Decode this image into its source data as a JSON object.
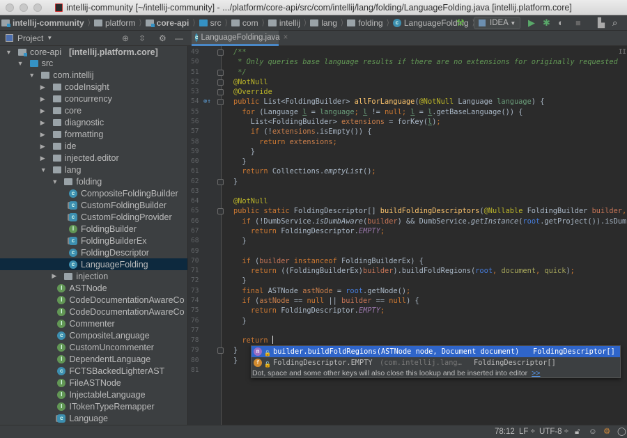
{
  "window": {
    "title": "intellij-community [~/intellij-community] - .../platform/core-api/src/com/intellij/lang/folding/LanguageFolding.java [intellij.platform.core]"
  },
  "navbar": {
    "breadcrumbs": [
      {
        "label": "intellij-community",
        "icon": "module-folder",
        "bold": true
      },
      {
        "label": "platform",
        "icon": "folder",
        "bold": false
      },
      {
        "label": "core-api",
        "icon": "module-folder",
        "bold": true
      },
      {
        "label": "src",
        "icon": "source-folder",
        "bold": false
      },
      {
        "label": "com",
        "icon": "package",
        "bold": false
      },
      {
        "label": "intellij",
        "icon": "package",
        "bold": false
      },
      {
        "label": "lang",
        "icon": "package",
        "bold": false
      },
      {
        "label": "folding",
        "icon": "package",
        "bold": false
      },
      {
        "label": "LanguageFolding",
        "icon": "class",
        "bold": false
      }
    ],
    "run_config": "IDEA"
  },
  "project_panel": {
    "title": "Project"
  },
  "editor_tab": {
    "label": "LanguageFolding.java",
    "close": "×"
  },
  "tree": [
    {
      "label": "core-api",
      "suffix": "[intellij.platform.core]",
      "depth": 0,
      "icon": "module",
      "expanded": true
    },
    {
      "label": "src",
      "depth": 1,
      "icon": "source",
      "expanded": true
    },
    {
      "label": "com.intellij",
      "depth": 2,
      "icon": "package",
      "expanded": true
    },
    {
      "label": "codeInsight",
      "depth": 3,
      "icon": "package",
      "expanded": false
    },
    {
      "label": "concurrency",
      "depth": 3,
      "icon": "package",
      "expanded": false
    },
    {
      "label": "core",
      "depth": 3,
      "icon": "package",
      "expanded": false
    },
    {
      "label": "diagnostic",
      "depth": 3,
      "icon": "package",
      "expanded": false
    },
    {
      "label": "formatting",
      "depth": 3,
      "icon": "package",
      "expanded": false
    },
    {
      "label": "ide",
      "depth": 3,
      "icon": "package",
      "expanded": false
    },
    {
      "label": "injected.editor",
      "depth": 3,
      "icon": "package",
      "expanded": false
    },
    {
      "label": "lang",
      "depth": 3,
      "icon": "package",
      "expanded": true
    },
    {
      "label": "folding",
      "depth": 4,
      "icon": "package",
      "expanded": true
    },
    {
      "label": "CompositeFoldingBuilder",
      "depth": 5,
      "icon": "class"
    },
    {
      "label": "CustomFoldingBuilder",
      "depth": 5,
      "icon": "abstract-class"
    },
    {
      "label": "CustomFoldingProvider",
      "depth": 5,
      "icon": "abstract-class"
    },
    {
      "label": "FoldingBuilder",
      "depth": 5,
      "icon": "interface"
    },
    {
      "label": "FoldingBuilderEx",
      "depth": 5,
      "icon": "abstract-class"
    },
    {
      "label": "FoldingDescriptor",
      "depth": 5,
      "icon": "class"
    },
    {
      "label": "LanguageFolding",
      "depth": 5,
      "icon": "class",
      "selected": true
    },
    {
      "label": "injection",
      "depth": 4,
      "icon": "package",
      "expanded": false
    },
    {
      "label": "ASTNode",
      "depth": 4,
      "icon": "interface"
    },
    {
      "label": "CodeDocumentationAwareCo",
      "depth": 4,
      "icon": "interface"
    },
    {
      "label": "CodeDocumentationAwareCo",
      "depth": 4,
      "icon": "interface"
    },
    {
      "label": "Commenter",
      "depth": 4,
      "icon": "interface"
    },
    {
      "label": "CompositeLanguage",
      "depth": 4,
      "icon": "class"
    },
    {
      "label": "CustomUncommenter",
      "depth": 4,
      "icon": "interface"
    },
    {
      "label": "DependentLanguage",
      "depth": 4,
      "icon": "interface"
    },
    {
      "label": "FCTSBackedLighterAST",
      "depth": 4,
      "icon": "class"
    },
    {
      "label": "FileASTNode",
      "depth": 4,
      "icon": "interface"
    },
    {
      "label": "InjectableLanguage",
      "depth": 4,
      "icon": "interface"
    },
    {
      "label": "ITokenTypeRemapper",
      "depth": 4,
      "icon": "interface"
    },
    {
      "label": "Language",
      "depth": 4,
      "icon": "abstract-class"
    }
  ],
  "code": {
    "first_line": 49,
    "lines": [
      [
        [
          "cm",
          "/**"
        ]
      ],
      [
        [
          "cm",
          " * Only queries base language results if there are no extensions for originally requested"
        ]
      ],
      [
        [
          "cm",
          " */"
        ]
      ],
      [
        [
          "an",
          "@NotNull"
        ]
      ],
      [
        [
          "an",
          "@Override"
        ]
      ],
      [
        [
          "kw",
          "public "
        ],
        [
          "",
          "List<FoldingBuilder> "
        ],
        [
          "fn",
          "allForLanguage"
        ],
        [
          "",
          "("
        ],
        [
          "an",
          "@NotNull "
        ],
        [
          "",
          "Language "
        ],
        [
          "pm",
          "language"
        ],
        [
          "",
          ") {"
        ]
      ],
      [
        [
          "",
          "  "
        ],
        [
          "kw",
          "for "
        ],
        [
          "",
          "(Language "
        ],
        [
          "lv",
          "l"
        ],
        [
          "",
          " = "
        ],
        [
          "pm",
          "language"
        ],
        [
          "kw",
          "; "
        ],
        [
          "lv",
          "l"
        ],
        [
          "",
          " != "
        ],
        [
          "kw",
          "null; "
        ],
        [
          "lv",
          "l"
        ],
        [
          "",
          " = "
        ],
        [
          "lv",
          "l"
        ],
        [
          "",
          ".getBaseLanguage()) {"
        ]
      ],
      [
        [
          "",
          "    List<FoldingBuilder> "
        ],
        [
          "fd",
          "extensions"
        ],
        [
          "",
          " = forKey("
        ],
        [
          "lv",
          "l"
        ],
        [
          "",
          ")"
        ],
        [
          "kw",
          ";"
        ]
      ],
      [
        [
          "",
          "    "
        ],
        [
          "kw",
          "if "
        ],
        [
          "",
          "(!"
        ],
        [
          "fd",
          "extensions"
        ],
        [
          "",
          ".isEmpty()) {"
        ]
      ],
      [
        [
          "",
          "      "
        ],
        [
          "kw",
          "return "
        ],
        [
          "fd",
          "extensions"
        ],
        [
          "kw",
          ";"
        ]
      ],
      [
        [
          "",
          "    }"
        ]
      ],
      [
        [
          "",
          "  }"
        ]
      ],
      [
        [
          "",
          "  "
        ],
        [
          "kw",
          "return "
        ],
        [
          "",
          "Collections."
        ],
        [
          "it",
          "emptyList"
        ],
        [
          "",
          "()"
        ],
        [
          "kw",
          ";"
        ]
      ],
      [
        [
          "",
          "}"
        ]
      ],
      [],
      [
        [
          "an",
          "@NotNull"
        ]
      ],
      [
        [
          "kw",
          "public static "
        ],
        [
          "",
          "FoldingDescriptor[] "
        ],
        [
          "fn",
          "buildFoldingDescriptors"
        ],
        [
          "",
          "("
        ],
        [
          "an",
          "@Nullable "
        ],
        [
          "",
          "FoldingBuilder "
        ],
        [
          "bp",
          "builder"
        ],
        [
          "kw",
          ","
        ]
      ],
      [
        [
          "",
          "  "
        ],
        [
          "kw",
          "if "
        ],
        [
          "",
          "(!DumbService."
        ],
        [
          "it",
          "isDumbAware"
        ],
        [
          "",
          "("
        ],
        [
          "bp",
          "builder"
        ],
        [
          "",
          ") && DumbService."
        ],
        [
          "it",
          "getInstance"
        ],
        [
          "",
          "("
        ],
        [
          "rt",
          "root"
        ],
        [
          "",
          ".getProject()).isDumbMode()"
        ]
      ],
      [
        [
          "",
          "    "
        ],
        [
          "kw",
          "return "
        ],
        [
          "",
          "FoldingDescriptor."
        ],
        [
          "st",
          "EMPTY"
        ],
        [
          "kw",
          ";"
        ]
      ],
      [
        [
          "",
          "  }"
        ]
      ],
      [],
      [
        [
          "",
          "  "
        ],
        [
          "kw",
          "if "
        ],
        [
          "",
          "("
        ],
        [
          "bp",
          "builder "
        ],
        [
          "kw",
          "instanceof "
        ],
        [
          "",
          "FoldingBuilderEx) {"
        ]
      ],
      [
        [
          "",
          "    "
        ],
        [
          "kw",
          "return "
        ],
        [
          "",
          "((FoldingBuilderEx)"
        ],
        [
          "bp",
          "builder"
        ],
        [
          "",
          ").buildFoldRegions("
        ],
        [
          "rt",
          "root"
        ],
        [
          "kw",
          ", "
        ],
        [
          "ol",
          "document"
        ],
        [
          "kw",
          ", "
        ],
        [
          "ol",
          "quick"
        ],
        [
          "",
          ")"
        ],
        [
          "kw",
          ";"
        ]
      ],
      [
        [
          "",
          "  }"
        ]
      ],
      [
        [
          "",
          "  "
        ],
        [
          "kw",
          "final "
        ],
        [
          "",
          "ASTNode "
        ],
        [
          "fd",
          "astNode"
        ],
        [
          "",
          " = "
        ],
        [
          "rt",
          "root"
        ],
        [
          "",
          ".getNode()"
        ],
        [
          "kw",
          ";"
        ]
      ],
      [
        [
          "",
          "  "
        ],
        [
          "kw",
          "if "
        ],
        [
          "",
          "("
        ],
        [
          "fd",
          "astNode"
        ],
        [
          "",
          " == "
        ],
        [
          "kw",
          "null "
        ],
        [
          "",
          "|| "
        ],
        [
          "bp",
          "builder"
        ],
        [
          "",
          " == "
        ],
        [
          "kw",
          "null"
        ],
        [
          "",
          ") {"
        ]
      ],
      [
        [
          "",
          "    "
        ],
        [
          "kw",
          "return "
        ],
        [
          "",
          "FoldingDescriptor."
        ],
        [
          "st",
          "EMPTY"
        ],
        [
          "kw",
          ";"
        ]
      ],
      [
        [
          "",
          "  }"
        ]
      ],
      [],
      [
        [
          "",
          "  "
        ],
        [
          "kw",
          "return "
        ]
      ],
      [
        [
          "",
          "}"
        ]
      ],
      [
        [
          "",
          "}"
        ]
      ],
      []
    ]
  },
  "completion": {
    "items": [
      {
        "icon": "method-icon",
        "text": "builder.buildFoldRegions(ASTNode node, Document document)",
        "detail": "",
        "type": "FoldingDescriptor[]",
        "selected": true
      },
      {
        "icon": "field-icon",
        "text": "FoldingDescriptor.EMPTY",
        "detail": "(com.intellij.lang…",
        "type": "FoldingDescriptor[]",
        "selected": false
      }
    ],
    "hint": "Dot, space and some other keys will also close this lookup and be inserted into editor",
    "hint_link": ">>"
  },
  "statusbar": {
    "position": "78:12",
    "line_separator": "LF ÷",
    "encoding": "UTF-8 ÷"
  },
  "colors": {
    "accent": "#4a88c7",
    "selection": "#0d293e",
    "popup_selection": "#2f65ca"
  }
}
